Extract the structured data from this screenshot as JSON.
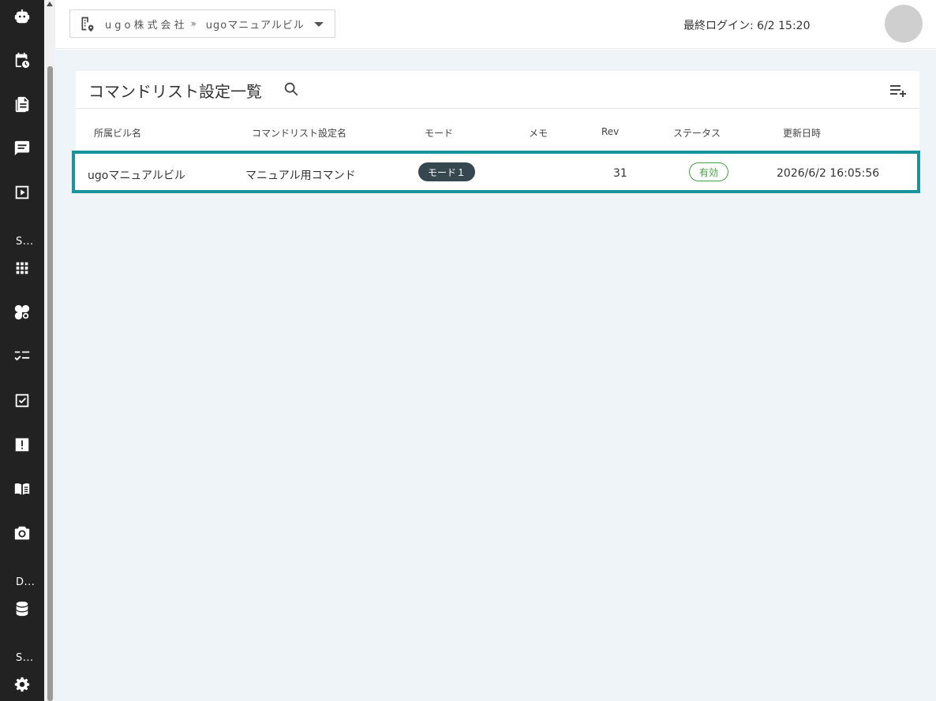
{
  "sidebar": {
    "items": [
      {
        "icon": "robot-icon"
      },
      {
        "icon": "calendar-clock-icon"
      },
      {
        "icon": "document-icon"
      },
      {
        "icon": "chat-icon"
      },
      {
        "icon": "play-box-icon"
      },
      {
        "icon": "grid-icon"
      },
      {
        "icon": "shapes-icon"
      },
      {
        "icon": "checklist-icon"
      },
      {
        "icon": "task-check-icon"
      },
      {
        "icon": "alert-icon"
      },
      {
        "icon": "manual-book-icon"
      },
      {
        "icon": "camera-icon"
      },
      {
        "icon": "database-icon"
      },
      {
        "icon": "gear-icon"
      }
    ],
    "section_labels": [
      "S...",
      "D...",
      "S..."
    ]
  },
  "header": {
    "company": "ugo株式会社",
    "separator": "»",
    "building": "ugoマニュアルビル",
    "last_login": "最終ログイン: 6/2 15:20"
  },
  "page": {
    "title": "コマンドリスト設定一覧"
  },
  "table": {
    "columns": [
      "所属ビル名",
      "コマンドリスト設定名",
      "モード",
      "メモ",
      "Rev",
      "ステータス",
      "更新日時"
    ],
    "rows": [
      {
        "building": "ugoマニュアルビル",
        "name": "マニュアル用コマンド",
        "mode": "モード１",
        "memo": "",
        "rev": "31",
        "status": "有効",
        "updated": "2026/6/2 16:05:56"
      }
    ]
  },
  "colors": {
    "sidebar_bg": "#222222",
    "highlight": "#17959a",
    "status_green": "#43a047",
    "mode_badge": "#37474f",
    "main_bg": "#eef4f7"
  }
}
